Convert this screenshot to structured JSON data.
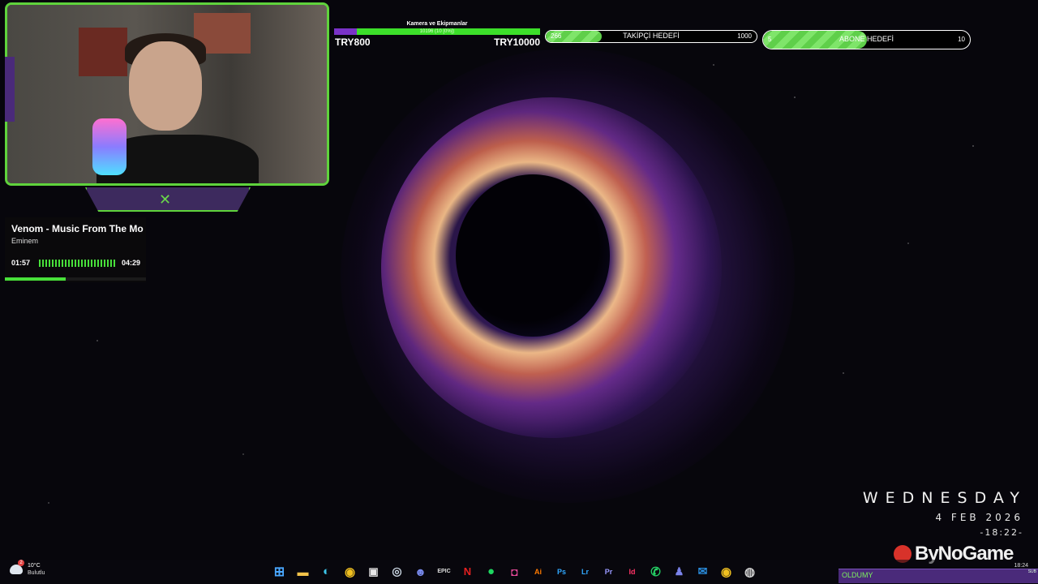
{
  "colors": {
    "accent_green": "#5fd33c",
    "accent_purple": "#7a32c8"
  },
  "music": {
    "title": "Venom - Music From The Mo",
    "artist": "Eminem",
    "elapsed": "01:57",
    "duration": "04:29",
    "progress_fraction": 0.43
  },
  "donation_goal": {
    "title": "Kamera ve Ekipmanlar",
    "bar_text": "10196 (10 [0%])",
    "current": "TRY800",
    "target": "TRY10000",
    "progress_fraction": 0.11
  },
  "follower_goal": {
    "label": "TAKİPÇİ HEDEFİ",
    "current": "266",
    "target": "1000",
    "progress_fraction": 0.266
  },
  "sub_goal": {
    "label": "ABONE HEDEFİ",
    "current": "5",
    "target": "10",
    "progress_fraction": 0.5
  },
  "clock_widget": {
    "day": "WEDNESDAY",
    "date": "4 FEB 2026",
    "time": "-18:22-"
  },
  "brand": {
    "name": "ByNoGame"
  },
  "taskbar": {
    "weather_temp": "10°C",
    "weather_condition": "Bulutlu",
    "weather_badge": "2",
    "time": "18:24",
    "icons": [
      "windows-start",
      "file-explorer",
      "edge",
      "chrome",
      "ms-store",
      "steam",
      "discord",
      "epic-games",
      "netflix",
      "spotify",
      "instagram",
      "illustrator",
      "photoshop",
      "lightroom",
      "premiere",
      "indesign",
      "whatsapp",
      "teams",
      "outlook",
      "chrome-alt",
      "obs"
    ]
  },
  "chat": {
    "username": "OLDUMY",
    "tag": "SUB"
  }
}
